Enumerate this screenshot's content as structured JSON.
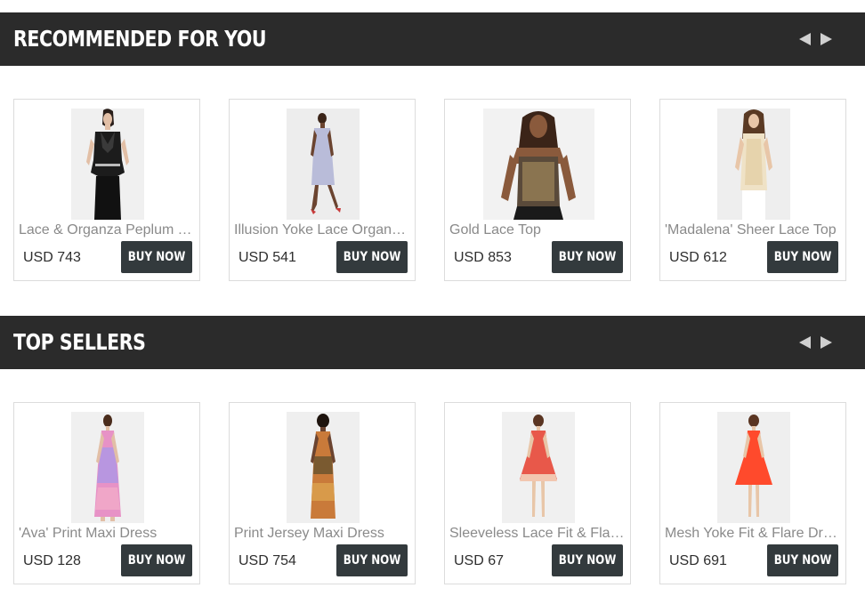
{
  "colors": {
    "header_bg": "#2b2b2b",
    "header_text": "#ffffff",
    "button_bg": "#333a3d",
    "button_text": "#ffffff",
    "product_name": "#8a8a8a",
    "price_text": "#2e2e2e",
    "arrow": "#d0d0d0",
    "card_border": "#dcdcdc"
  },
  "sections": [
    {
      "title": "RECOMMENDED FOR YOU",
      "prev_icon": "left-arrow-icon",
      "next_icon": "right-arrow-icon",
      "products": [
        {
          "name": "Lace & Organza Peplum Top",
          "price": "USD 743",
          "button": "BUY NOW",
          "image": "black-lace-peplum-top-photo"
        },
        {
          "name": "Illusion Yoke Lace Organza Dress",
          "price": "USD 541",
          "button": "BUY NOW",
          "image": "lavender-lace-dress-photo"
        },
        {
          "name": "Gold Lace Top",
          "price": "USD 853",
          "button": "BUY NOW",
          "image": "gold-lace-top-photo"
        },
        {
          "name": "'Madalena' Sheer Lace Top",
          "price": "USD 612",
          "button": "BUY NOW",
          "image": "cream-lace-top-photo"
        }
      ]
    },
    {
      "title": "TOP SELLERS",
      "prev_icon": "left-arrow-icon",
      "next_icon": "right-arrow-icon",
      "products": [
        {
          "name": "'Ava' Print Maxi Dress",
          "price": "USD 128",
          "button": "BUY NOW",
          "image": "pink-print-maxi-dress-photo"
        },
        {
          "name": "Print Jersey Maxi Dress",
          "price": "USD 754",
          "button": "BUY NOW",
          "image": "orange-print-maxi-dress-photo"
        },
        {
          "name": "Sleeveless Lace Fit & Flare Dress",
          "price": "USD 67",
          "button": "BUY NOW",
          "image": "coral-lace-dress-photo"
        },
        {
          "name": "Mesh Yoke Fit & Flare Dress",
          "price": "USD 691",
          "button": "BUY NOW",
          "image": "coral-fit-flare-dress-photo"
        }
      ]
    }
  ]
}
